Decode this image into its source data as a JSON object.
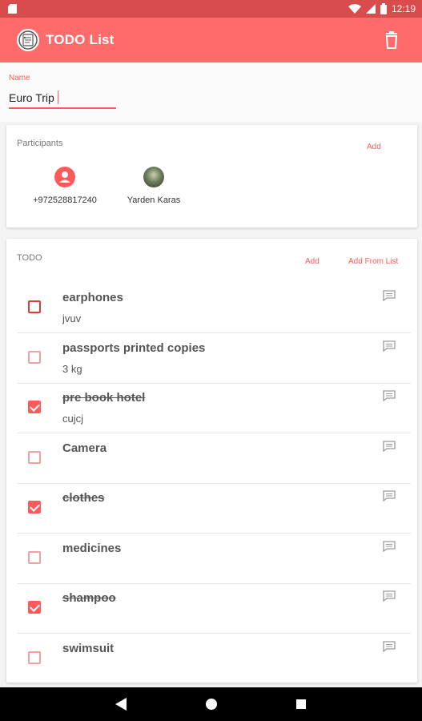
{
  "status_bar": {
    "time": "12:19"
  },
  "app_bar": {
    "title": "TODO List",
    "icons": [
      "app-logo-icon",
      "trash-icon"
    ]
  },
  "name_field": {
    "label": "Name",
    "value": "Euro Trip"
  },
  "participants": {
    "title": "Participants",
    "add_label": "Add",
    "people": [
      {
        "name": "+972528817240",
        "avatar": "person-icon"
      },
      {
        "name": "Yarden Karas",
        "avatar": "photo-avatar"
      }
    ]
  },
  "todo": {
    "title": "TODO",
    "add_label": "Add",
    "add_from_list_label": "Add From List",
    "items": [
      {
        "title": "earphones",
        "subtitle": "jvuv",
        "checked": false
      },
      {
        "title": "passports printed copies",
        "subtitle": "3 kg",
        "checked": false
      },
      {
        "title": "pre book hotel",
        "subtitle": "cujcj",
        "checked": true
      },
      {
        "title": "Camera",
        "subtitle": "",
        "checked": false
      },
      {
        "title": "clothes",
        "subtitle": "",
        "checked": true
      },
      {
        "title": "medicines",
        "subtitle": "",
        "checked": false
      },
      {
        "title": "shampoo",
        "subtitle": "",
        "checked": true
      },
      {
        "title": "swimsuit",
        "subtitle": "",
        "checked": false
      }
    ]
  },
  "colors": {
    "primary": "#ff6b6b",
    "status_bar": "#d84c4c",
    "accent": "#ff5a5a"
  }
}
